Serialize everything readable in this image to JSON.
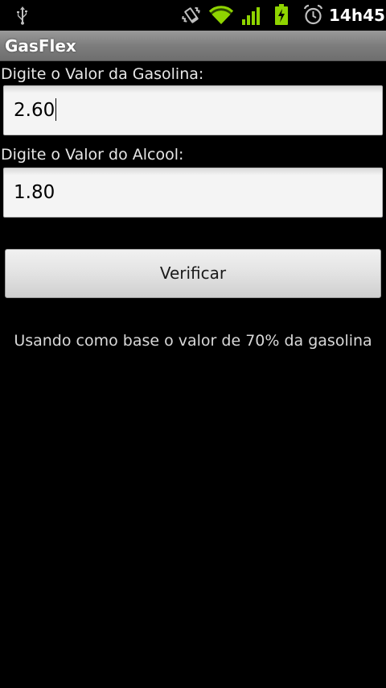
{
  "status_bar": {
    "time": "14h45",
    "icons": [
      "usb-icon",
      "vibrate-icon",
      "wifi-icon",
      "signal-icon",
      "battery-charging-icon",
      "alarm-icon"
    ],
    "accent_color": "#8fd400"
  },
  "app": {
    "title": "GasFlex"
  },
  "form": {
    "gasoline_label": "Digite o Valor da Gasolina:",
    "gasoline_value": "2.60",
    "alcohol_label": "Digite o Valor do Alcool:",
    "alcohol_value": "1.80",
    "button_label": "Verificar",
    "info_text": "Usando como base o valor de 70% da gasolina"
  }
}
